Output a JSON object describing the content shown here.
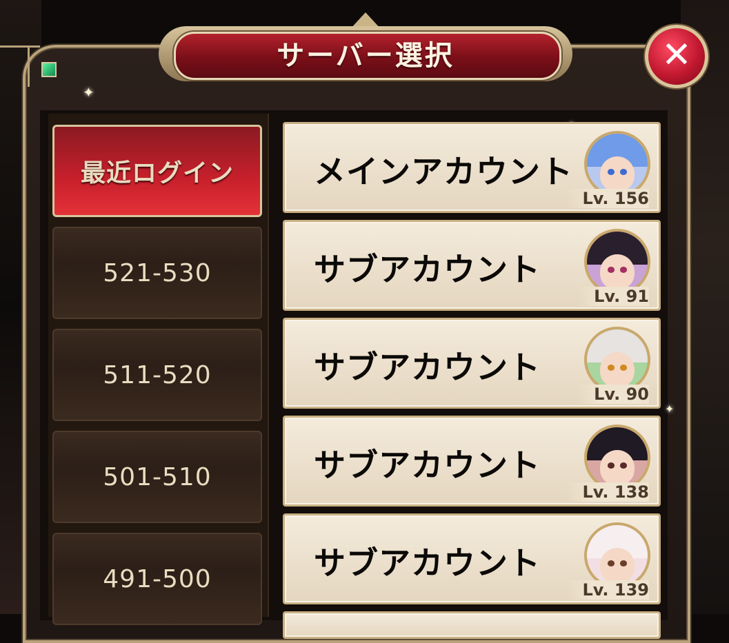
{
  "title": "サーバー選択",
  "close_icon": "close-x-icon",
  "tabs": [
    {
      "label": "最近ログイン",
      "active": true
    },
    {
      "label": "521-530",
      "active": false
    },
    {
      "label": "511-520",
      "active": false
    },
    {
      "label": "501-510",
      "active": false
    },
    {
      "label": "491-500",
      "active": false
    }
  ],
  "accounts": [
    {
      "label": "メインアカウント",
      "level": "Lv. 156"
    },
    {
      "label": "サブアカウント",
      "level": "Lv. 91"
    },
    {
      "label": "サブアカウント",
      "level": "Lv. 90"
    },
    {
      "label": "サブアカウント",
      "level": "Lv. 138"
    },
    {
      "label": "サブアカウント",
      "level": "Lv. 139"
    }
  ],
  "colors": {
    "accent_red": "#c8202c",
    "gold_border": "#c9b083",
    "card_bg": "#f4ebdc",
    "dark_panel": "#22180f"
  }
}
